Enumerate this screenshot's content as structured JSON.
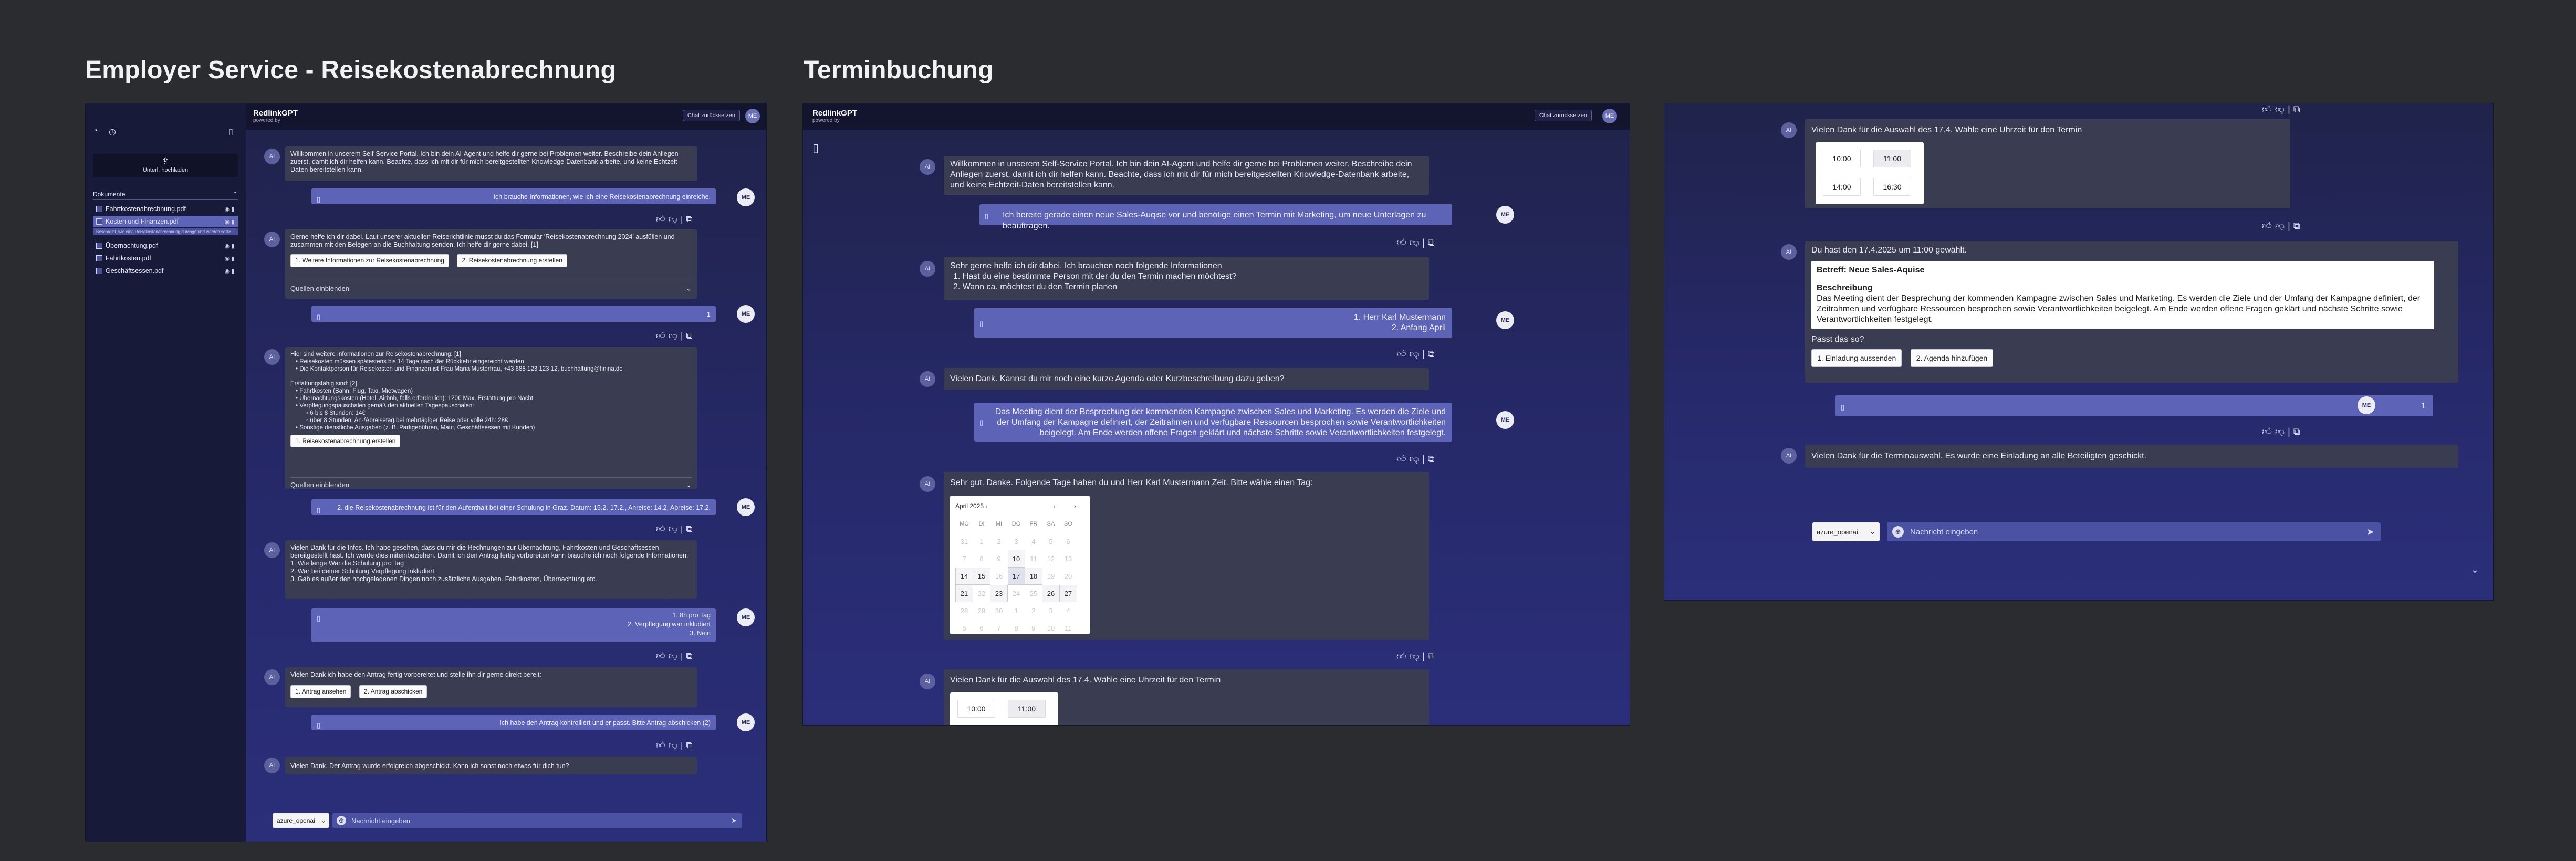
{
  "titles": {
    "left": "Employer Service - Reisekostenabrechnung",
    "mid": "Terminbuchung"
  },
  "colors": {
    "bg": "#2b2c30",
    "frame": "#23265c",
    "bot_bubble": "#3a3d52",
    "user_bubble": "#5d64b8",
    "accent": "#5c609c"
  },
  "app": {
    "name": "RedlinkGPT",
    "powered": "powered by",
    "reset": "Chat zurücksetzen",
    "avatar": "ME",
    "ai": "AI",
    "me": "ME",
    "model": "azure_openai",
    "input_placeholder": "Nachricht eingeben",
    "sources_label": "Quellen einblenden"
  },
  "left": {
    "upload_label": "Unterl. hochladen",
    "documents_label": "Dokumente",
    "docs": [
      "Fahrtkostenabrechnung.pdf",
      "Kosten und Finanzen.pdf",
      "Übernachtung.pdf",
      "Fahrtkosten.pdf",
      "Geschäftsessen.pdf"
    ],
    "doc_hint": "Beschreibt, wie eine Reisekostenabrechnung durchgeführt werden sollte",
    "m1": "Willkommen in unserem Self-Service Portal. Ich bin dein AI-Agent und helfe dir gerne bei Problemen weiter. Beschreibe dein Anliegen zuerst, damit ich dir helfen kann. Beachte, dass ich mit dir für mich bereitgestellten Knowledge-Datenbank arbeite, und keine Echtzeit-Daten bereitstellen kann.",
    "u1": "Ich brauche Informationen, wie ich eine Reisekostenabrechnung einreiche.",
    "m2": "Gerne helfe ich dir dabei. Laut unserer aktuellen Reiserichtlinie musst du das Formular 'Reisekostenabrechnung 2024' ausfüllen und zusammen mit den Belegen an die Buchhaltung senden. Ich helfe dir gerne dabei. [1]",
    "m2_chips": [
      "1. Weitere Informationen zur Reisekostenabrechnung",
      "2. Reisekostenabrechnung erstellen"
    ],
    "u2": "1",
    "m3_title": "Hier sind weitere Informationen zur Reisekostenabrechnung: [1]",
    "m3_lines": [
      "•  Reisekosten müssen spätestens bis 14 Tage nach der Rückkehr eingereicht werden",
      "•  Die Kontaktperson für Reisekosten und Finanzen ist Frau Maria Musterfrau, +43 688 123 123 12, buchhaltung@finina.de",
      "Erstattungsfähig sind: [2]",
      "•  Fahrtkosten (Bahn, Flug, Taxi, Mietwagen)",
      "•  Übernachtungskosten (Hotel, Airbnb, falls erforderlich): 120€ Max. Erstattung pro Nacht",
      "•  Verpflegungspauschalen gemäß den aktuellen Tagespauschalen:",
      "      ◦  6 bis 8 Stunden: 14€",
      "      ◦  über 8 Stunden, An-/Abreisetag bei mehrtägiger Reise oder volle 24h: 28€",
      "•  Sonstige dienstliche Ausgaben (z. B. Parkgebühren, Maut, Geschäftsessen mit Kunden)"
    ],
    "m3_chip": "1. Reisekostenabrechnung erstellen",
    "u3": "2. die Reisekostenabrechnung ist für den Aufenthalt bei einer Schulung in Graz. Datum: 15.2.-17.2., Anreise: 14.2, Abreise: 17.2.",
    "m4": "Vielen Dank für die Infos. Ich habe gesehen, dass du mir die Rechnungen zur Übernachtung, Fahrtkosten und Geschäftsessen bereitgestellt hast. Ich werde dies miteinbeziehen. Damit ich den Antrag fertig vorbereiten kann brauche ich noch folgende Informationen:",
    "m4_lines": [
      "1. Wie lange War die Schulung pro Tag",
      "2. War bei deiner Schulung Verpflegung inkludiert",
      "3. Gab es außer den hochgeladenen Dingen noch zusätzliche Ausgaben. Fahrtkosten, Übernachtung etc."
    ],
    "u4_lines": [
      "1. 8h pro Tag",
      "2. Verpflegung war inkludiert",
      "3. Nein"
    ],
    "m5": "Vielen Dank ich habe den Antrag fertig vorbereitet und stelle ihn dir gerne direkt bereit:",
    "m5_chips": [
      "1. Antrag ansehen",
      "2. Antrag abschicken"
    ],
    "u5": "Ich habe den Antrag kontrolliert und er passt. Bitte Antrag abschicken (2)",
    "m6": "Vielen Dank. Der Antrag wurde erfolgreich abgeschickt. Kann ich sonst noch etwas für dich tun?"
  },
  "mid": {
    "m1": "Willkommen in unserem Self-Service Portal. Ich bin dein AI-Agent und helfe dir gerne bei Problemen weiter. Beschreibe dein Anliegen zuerst, damit ich dir helfen kann. Beachte, dass ich mit dir für mich bereitgestellten Knowledge-Datenbank arbeite, und keine Echtzeit-Daten bereitstellen kann.",
    "u1": "Ich bereite gerade einen neue Sales-Auqise vor und benötige einen Termin mit Marketing, um neue Unterlagen zu beauftragen.",
    "m2": "Sehr gerne helfe ich dir dabei. Ich brauchen noch folgende Informationen",
    "m2_lines": [
      "1. Hast du eine bestimmte Person mit der du den Termin machen möchtest?",
      "2. Wann ca. möchtest du den Termin planen"
    ],
    "u2_lines": [
      "1. Herr Karl Mustermann",
      "2. Anfang April"
    ],
    "m3": "Vielen Dank. Kannst du mir noch eine kurze Agenda oder Kurzbeschreibung dazu geben?",
    "u3": "Das Meeting dient der Besprechung der kommenden Kampagne zwischen Sales und Marketing. Es werden die Ziele und der Umfang der Kampagne definiert, der Zeitrahmen und verfügbare Ressourcen besprochen sowie Verantwortlichkeiten beigelegt. Am Ende werden offene Fragen geklärt und nächste Schritte sowie Verantwortlichkeiten festgelegt.",
    "m4": "Sehr gut. Danke. Folgende Tage haben du und Herr Karl Mustermann Zeit. Bitte wähle einen Tag:",
    "cal_month": "April 2025 ›",
    "cal_head": [
      "MO",
      "DI",
      "MI",
      "DO",
      "FR",
      "SA",
      "SO"
    ],
    "cal_rows": [
      [
        "31",
        "1",
        "2",
        "3",
        "4",
        "5",
        "6"
      ],
      [
        "7",
        "8",
        "9",
        "10",
        "11",
        "12",
        "13"
      ],
      [
        "14",
        "15",
        "16",
        "17",
        "18",
        "19",
        "20"
      ],
      [
        "21",
        "22",
        "23",
        "24",
        "25",
        "26",
        "27"
      ],
      [
        "28",
        "29",
        "30",
        "1",
        "2",
        "3",
        "4"
      ],
      [
        "5",
        "6",
        "7",
        "8",
        "9",
        "10",
        "11"
      ]
    ],
    "m5": "Vielen Dank für die Auswahl des 17.4. Wähle eine Uhrzeit für den Termin",
    "times_partial": [
      "10:00",
      "11:00"
    ]
  },
  "right": {
    "m1": "Vielen Dank für die Auswahl des 17.4. Wähle eine Uhrzeit für den Termin",
    "times": [
      "10:00",
      "11:00",
      "14:00",
      "16:30"
    ],
    "m2": "Du hast den 17.4.2025 um 11:00 gewählt.",
    "card_subject": "Betreff: Neue Sales-Aquise",
    "card_heading": "Beschreibung",
    "card_text": "Das Meeting dient der Besprechung der kommenden Kampagne zwischen Sales und Marketing. Es werden die Ziele und der Umfang der Kampagne definiert, der Zeitrahmen und verfügbare Ressourcen besprochen sowie Verantwortlichkeiten beigelegt. Am Ende werden offene Fragen geklärt und nächste Schritte sowie Verantwortlichkeiten festgelegt.",
    "question": "Passt das so?",
    "chips": [
      "1. Einladung aussenden",
      "2. Agenda hinzufügen"
    ],
    "u1": "1",
    "m3": "Vielen Dank für die Terminauswahl. Es wurde eine Einladung an alle Beteiligten geschickt."
  }
}
